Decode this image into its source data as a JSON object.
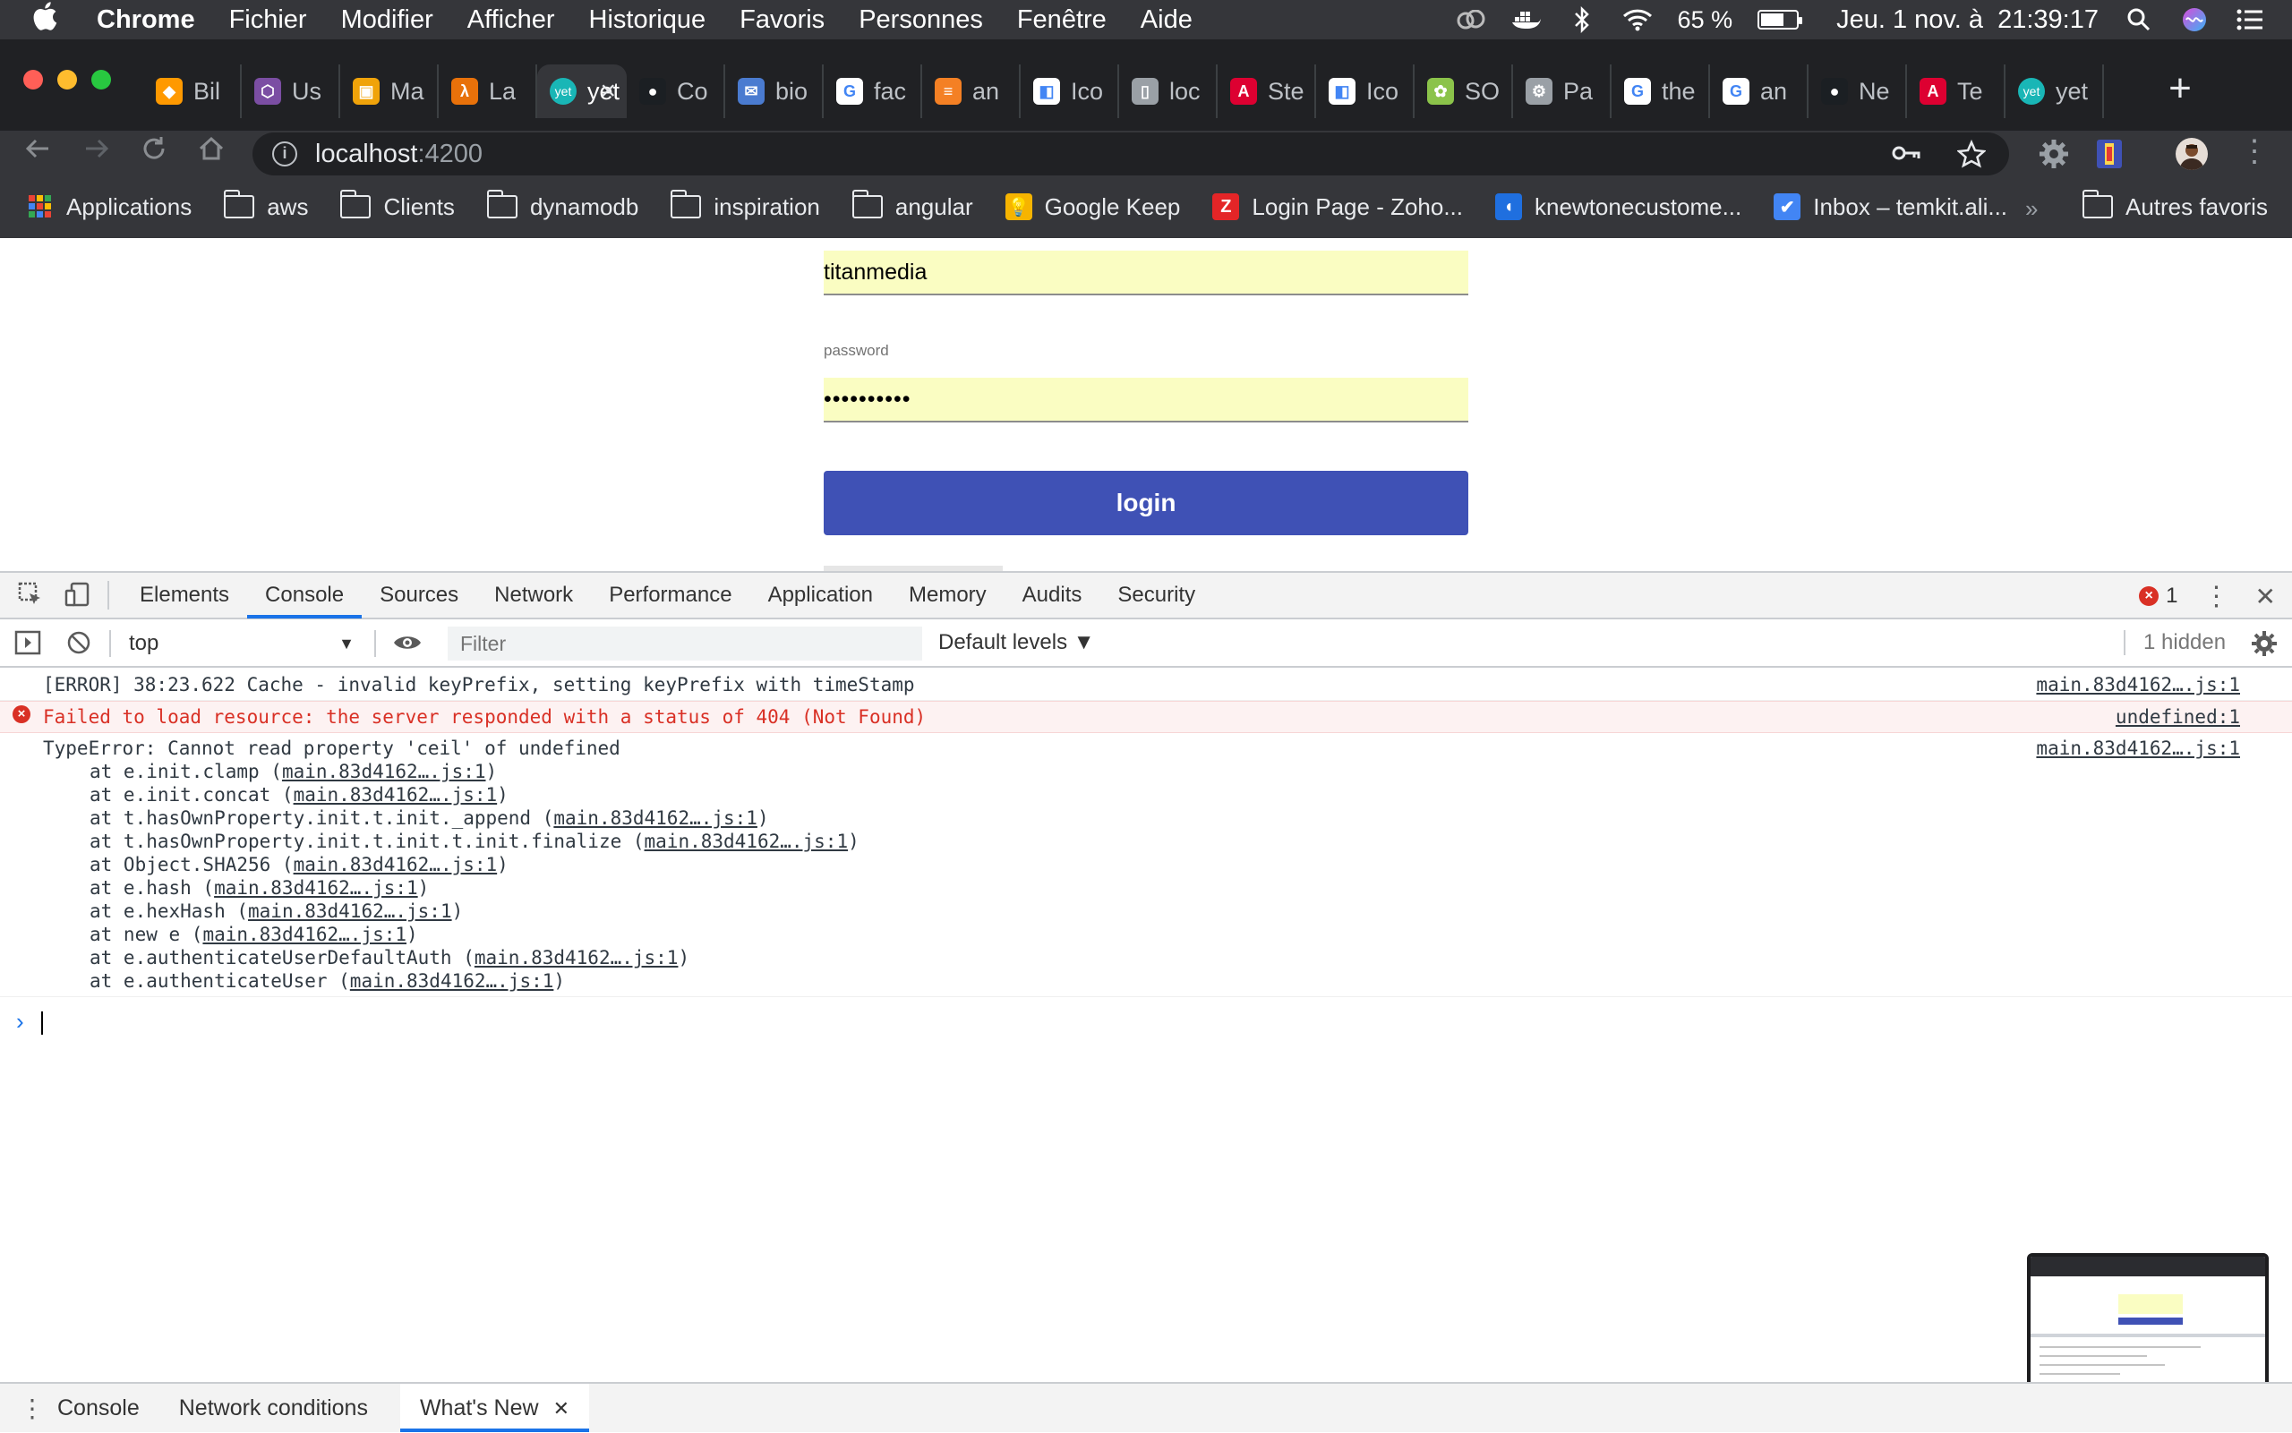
{
  "menubar": {
    "app": "Chrome",
    "items": [
      "Fichier",
      "Modifier",
      "Afficher",
      "Historique",
      "Favoris",
      "Personnes",
      "Fenêtre",
      "Aide"
    ],
    "battery_percent": "65 %",
    "battery_level": 0.65,
    "datetime": "Jeu. 1 nov. à  21:39:17"
  },
  "tabs": [
    {
      "label": "Bil",
      "fav_color": "#ff9900",
      "fav_glyph": "◆"
    },
    {
      "label": "Us",
      "fav_color": "#7b4ea3",
      "fav_glyph": "⬡"
    },
    {
      "label": "Ma",
      "fav_color": "#f0a30a",
      "fav_glyph": "▣"
    },
    {
      "label": "La",
      "fav_color": "#e8710a",
      "fav_glyph": "λ"
    },
    {
      "label": "yet",
      "fav_color": "#19b6b6",
      "fav_glyph": "yet",
      "active": true
    },
    {
      "label": "Co",
      "fav_color": "#1b1f23",
      "fav_glyph": "●"
    },
    {
      "label": "bio",
      "fav_color": "#4a7bd0",
      "fav_glyph": "✉"
    },
    {
      "label": "fac",
      "fav_color": "#ffffff",
      "fav_glyph": "G"
    },
    {
      "label": "an",
      "fav_color": "#f48024",
      "fav_glyph": "≡"
    },
    {
      "label": "Ico",
      "fav_color": "#ffffff",
      "fav_glyph": "◧"
    },
    {
      "label": "loc",
      "fav_color": "#9aa0a6",
      "fav_glyph": "▯"
    },
    {
      "label": "Ste",
      "fav_color": "#dd0031",
      "fav_glyph": "A"
    },
    {
      "label": "Ico",
      "fav_color": "#ffffff",
      "fav_glyph": "◧"
    },
    {
      "label": "SO",
      "fav_color": "#8bc34a",
      "fav_glyph": "✿"
    },
    {
      "label": "Pa",
      "fav_color": "#9aa0a6",
      "fav_glyph": "⚙"
    },
    {
      "label": "the",
      "fav_color": "#ffffff",
      "fav_glyph": "G"
    },
    {
      "label": "an",
      "fav_color": "#ffffff",
      "fav_glyph": "G"
    },
    {
      "label": "Ne",
      "fav_color": "#1b1f23",
      "fav_glyph": "●"
    },
    {
      "label": "Te",
      "fav_color": "#dd0031",
      "fav_glyph": "A"
    },
    {
      "label": "yet",
      "fav_color": "#19b6b6",
      "fav_glyph": "yet"
    }
  ],
  "address": {
    "host": "localhost",
    "port": ":4200"
  },
  "bookmarks": [
    {
      "label": "Applications",
      "kind": "apps"
    },
    {
      "label": "aws",
      "kind": "folder"
    },
    {
      "label": "Clients",
      "kind": "folder"
    },
    {
      "label": "dynamodb",
      "kind": "folder"
    },
    {
      "label": "inspiration",
      "kind": "folder"
    },
    {
      "label": "angular",
      "kind": "folder"
    },
    {
      "label": "Google Keep",
      "kind": "site",
      "color": "#f6b400",
      "glyph": "💡"
    },
    {
      "label": "Login Page - Zoho...",
      "kind": "site",
      "color": "#e42527",
      "glyph": "Z"
    },
    {
      "label": "knewtonecustome...",
      "kind": "site",
      "color": "#1f6fdf",
      "glyph": "◖"
    },
    {
      "label": "Inbox – temkit.ali...",
      "kind": "site",
      "color": "#4285f4",
      "glyph": "✔"
    }
  ],
  "bookmarks_more": "»",
  "bookmarks_other": "Autres favoris",
  "page": {
    "username_value": "titanmedia",
    "password_label": "password",
    "password_value": "••••••••••",
    "login_label": "login"
  },
  "devtools": {
    "tabs": [
      "Elements",
      "Console",
      "Sources",
      "Network",
      "Performance",
      "Application",
      "Memory",
      "Audits",
      "Security"
    ],
    "active_tab": "Console",
    "error_count": "1",
    "context": "top",
    "filter_placeholder": "Filter",
    "levels": "Default levels ▼",
    "hidden": "1 hidden",
    "messages": [
      {
        "type": "log",
        "text": "[ERROR] 38:23.622 Cache - invalid keyPrefix, setting keyPrefix with timeStamp",
        "src": "main.83d4162….js:1"
      },
      {
        "type": "error",
        "text": "Failed to load resource: the server responded with a status of 404 (Not Found)",
        "src": "undefined:1"
      },
      {
        "type": "log",
        "text": "TypeError: Cannot read property 'ceil' of undefined",
        "src": "main.83d4162….js:1"
      }
    ],
    "stack": [
      {
        "prefix": "at e.init.clamp (",
        "link": "main.83d4162….js:1",
        "suffix": ")"
      },
      {
        "prefix": "at e.init.concat (",
        "link": "main.83d4162….js:1",
        "suffix": ")"
      },
      {
        "prefix": "at t.hasOwnProperty.init.t.init._append (",
        "link": "main.83d4162….js:1",
        "suffix": ")"
      },
      {
        "prefix": "at t.hasOwnProperty.init.t.init.t.init.finalize (",
        "link": "main.83d4162….js:1",
        "suffix": ")"
      },
      {
        "prefix": "at Object.SHA256 (",
        "link": "main.83d4162….js:1",
        "suffix": ")"
      },
      {
        "prefix": "at e.hash (",
        "link": "main.83d4162….js:1",
        "suffix": ")"
      },
      {
        "prefix": "at e.hexHash (",
        "link": "main.83d4162….js:1",
        "suffix": ")"
      },
      {
        "prefix": "at new e (",
        "link": "main.83d4162….js:1",
        "suffix": ")"
      },
      {
        "prefix": "at e.authenticateUserDefaultAuth (",
        "link": "main.83d4162….js:1",
        "suffix": ")"
      },
      {
        "prefix": "at e.authenticateUser (",
        "link": "main.83d4162….js:1",
        "suffix": ")"
      }
    ],
    "prompt": "›",
    "drawer_tabs": [
      "Console",
      "Network conditions",
      "What's New"
    ],
    "drawer_active": "What's New"
  }
}
